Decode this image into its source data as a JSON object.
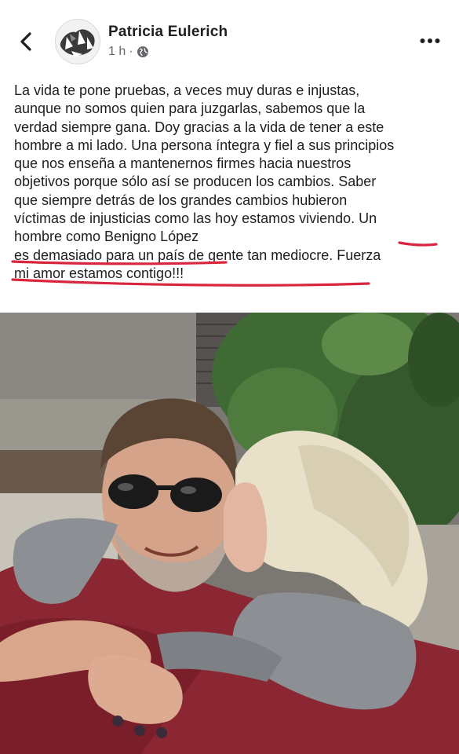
{
  "post": {
    "author": "Patricia Eulerich",
    "timestamp": "1 h",
    "privacy_icon": "globe-icon",
    "lines": [
      "La vida te pone pruebas, a veces muy duras e injustas,",
      "aunque no somos quien para juzgarlas, sabemos que la",
      "verdad siempre gana. Doy gracias a la vida de tener a este",
      "hombre a mi lado. Una persona íntegra y fiel a sus principios",
      "que nos enseña a mantenernos firmes hacia nuestros",
      "objetivos porque sólo así se producen los cambios. Saber",
      "que siempre detrás de los grandes cambios hubieron",
      "víctimas de injusticias como las hoy estamos viviendo. Un",
      "hombre como Benigno López",
      "es demasiado para un país de gente tan mediocre. Fuerza",
      "mi amor estamos contigo!!!"
    ]
  },
  "colors": {
    "text": "#1c1e21",
    "secondary": "#65676b",
    "underline": "#d7263d",
    "background": "#ffffff"
  },
  "icons": {
    "back": "chevron-left-icon",
    "more": "more-horizontal-icon"
  }
}
